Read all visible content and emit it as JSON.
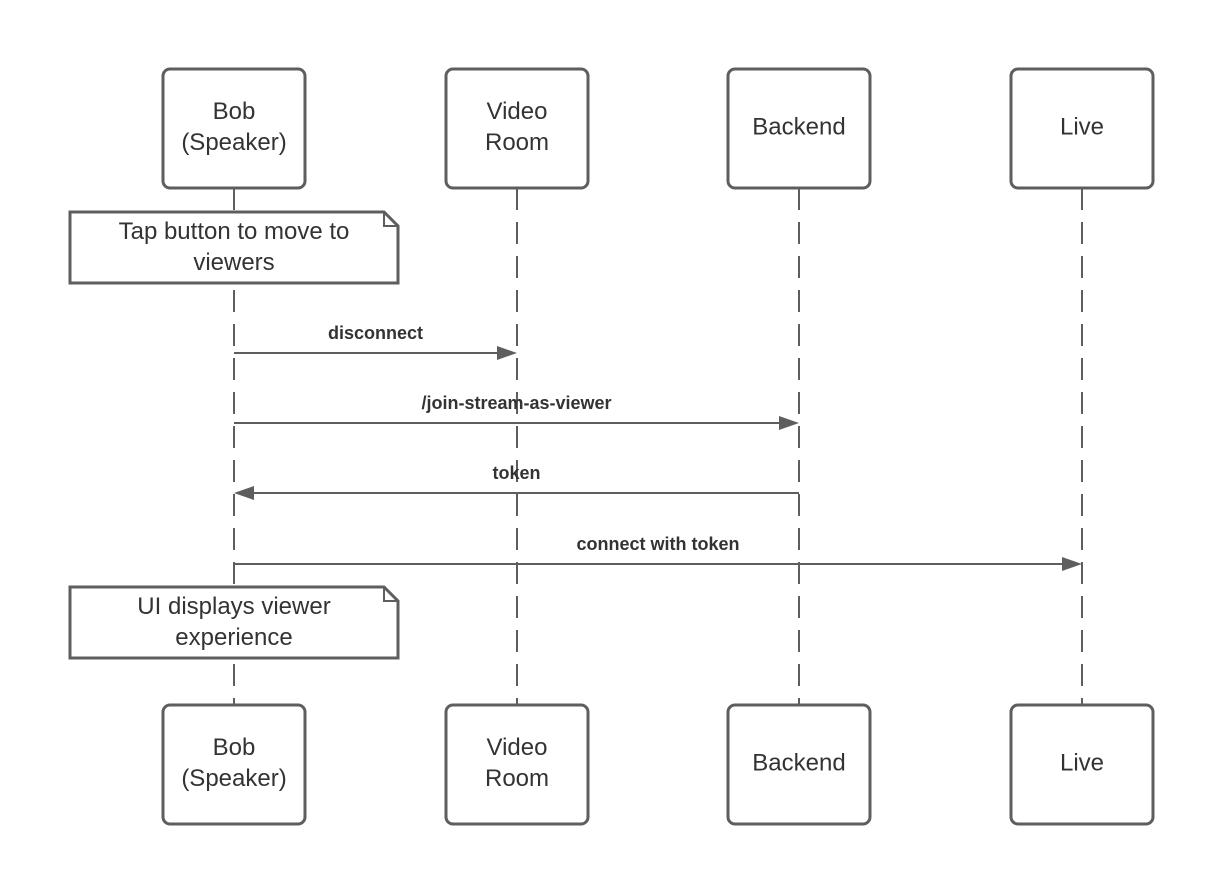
{
  "diagram": {
    "type": "sequence",
    "colors": {
      "stroke": "#5e5e5e",
      "text": "#333333",
      "background": "#ffffff"
    },
    "participants": [
      {
        "id": "bob",
        "lines": [
          "Bob",
          "(Speaker)"
        ]
      },
      {
        "id": "video",
        "lines": [
          "Video",
          "Room"
        ]
      },
      {
        "id": "backend",
        "lines": [
          "Backend"
        ]
      },
      {
        "id": "live",
        "lines": [
          "Live"
        ]
      }
    ],
    "steps": [
      {
        "kind": "note",
        "over": "bob",
        "lines": [
          "Tap button to move to",
          "viewers"
        ]
      },
      {
        "kind": "message",
        "from": "bob",
        "to": "video",
        "label": "disconnect"
      },
      {
        "kind": "message",
        "from": "bob",
        "to": "backend",
        "label": "/join-stream-as-viewer"
      },
      {
        "kind": "message",
        "from": "backend",
        "to": "bob",
        "label": "token"
      },
      {
        "kind": "message",
        "from": "bob",
        "to": "live",
        "label": "connect with token"
      },
      {
        "kind": "note",
        "over": "bob",
        "lines": [
          "UI displays viewer",
          "experience"
        ]
      }
    ]
  }
}
